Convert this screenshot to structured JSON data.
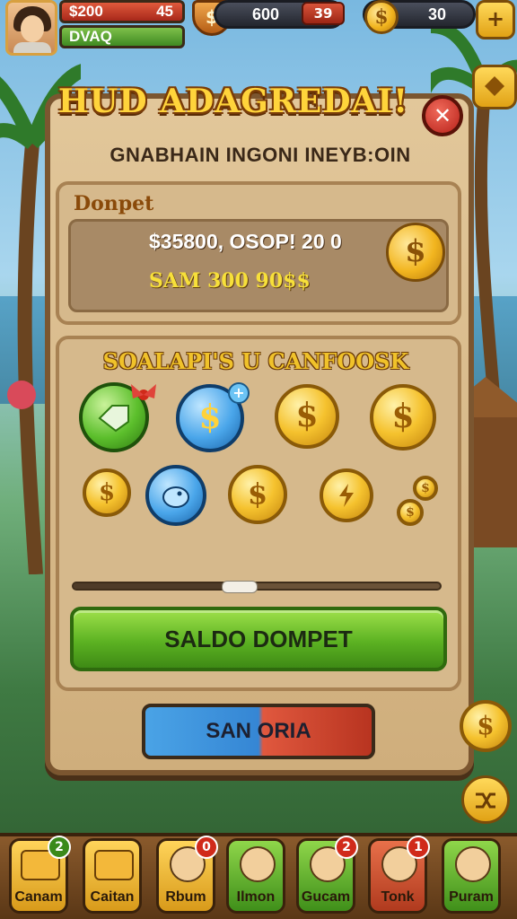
{
  "hud": {
    "money_value": "$200",
    "money_right": "45",
    "green_bar_text": "DVAQ",
    "center_pill_value": "600",
    "red_tag_text": "39",
    "right_pill_value": "30",
    "plus_label": "+",
    "coin_symbol": "$"
  },
  "panel": {
    "title": "HUD ADAGREDAI!",
    "subtitle": "GNABHAIN INGONI INEYB:OIN",
    "close_symbol": "✕"
  },
  "wallet": {
    "label": "Donpet",
    "amount": "$35800, OSOP! 20 0",
    "sub": "SAM 300 90$$"
  },
  "coins": {
    "title": "SOALAPI'S U CANFOOSK"
  },
  "slider": {
    "value": 0.45
  },
  "buttons": {
    "primary": "SALDO DOMPET",
    "split": "SAN ORIA"
  },
  "nav": [
    {
      "label": "Canam",
      "badge": "2"
    },
    {
      "label": "Caitan",
      "badge": ""
    },
    {
      "label": "Rbum",
      "badge": "0"
    },
    {
      "label": "Ilmon",
      "badge": ""
    },
    {
      "label": "Gucam",
      "badge": "2"
    },
    {
      "label": "Tonk",
      "badge": "1"
    },
    {
      "label": "Puram",
      "badge": ""
    }
  ]
}
